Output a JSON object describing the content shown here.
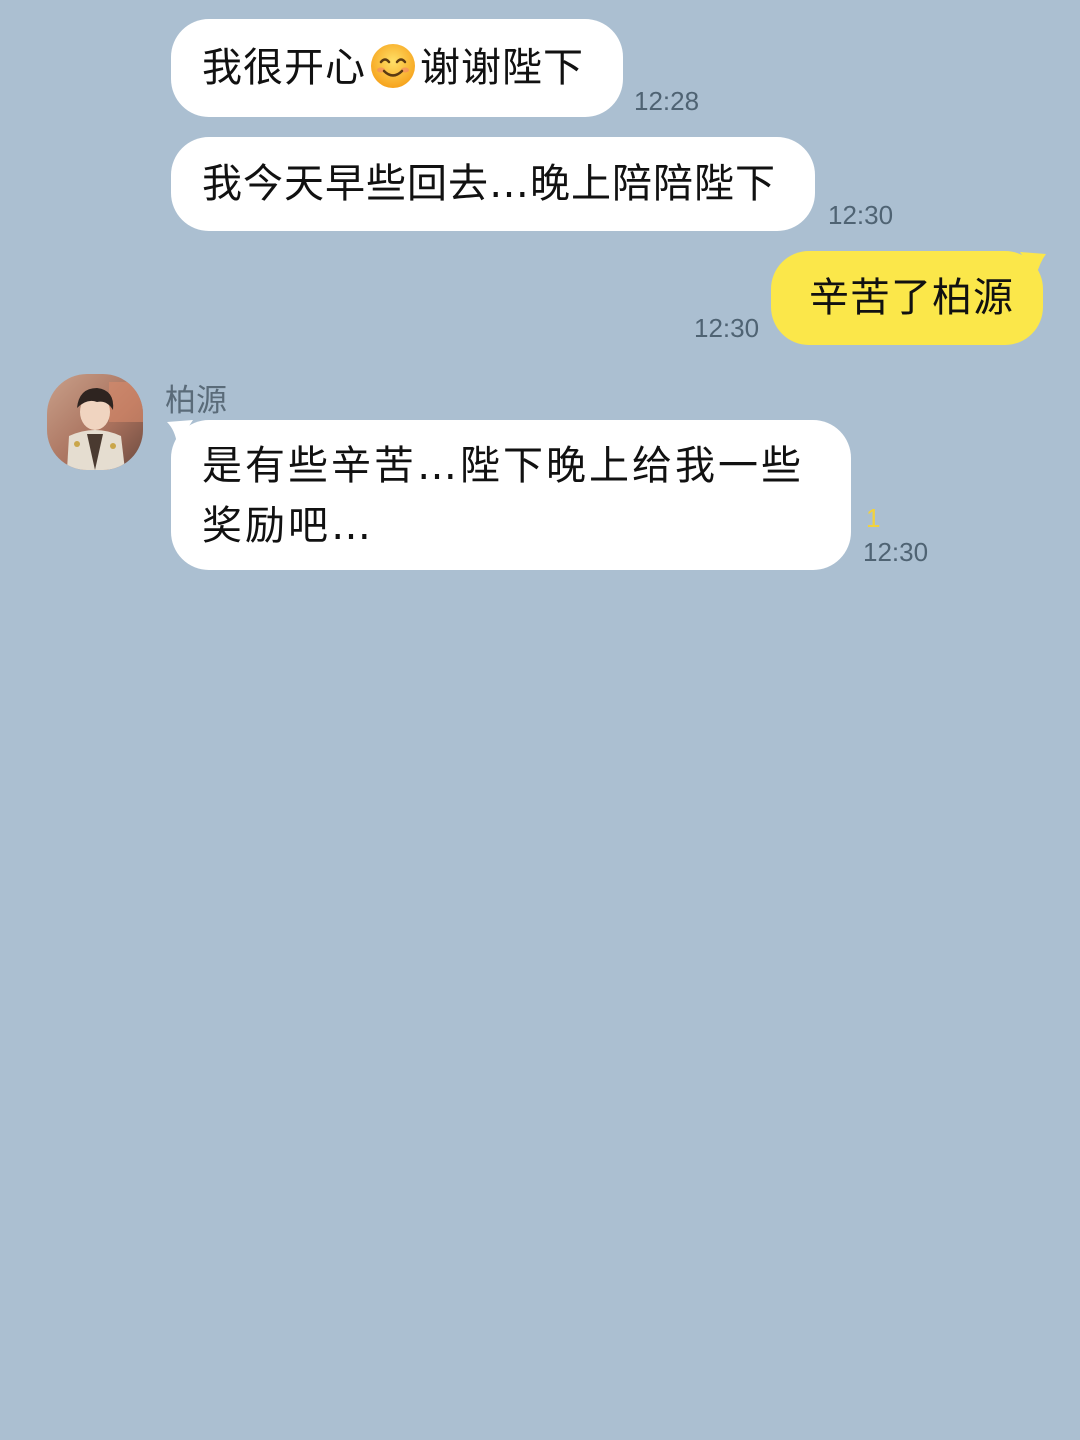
{
  "chat": {
    "messages": [
      {
        "sender": "other",
        "text_before": "我很开心",
        "emoji": "smiling-face-emoji",
        "text_after": "谢谢陛下",
        "time": "12:28"
      },
      {
        "sender": "other",
        "text": "我今天早些回去…晚上陪陪陛下",
        "time": "12:30"
      },
      {
        "sender": "me",
        "text": "辛苦了柏源",
        "time": "12:30"
      },
      {
        "sender": "other",
        "name": "柏源",
        "line1": "是有些辛苦…陛下晚上给我一些",
        "line2": "奖励吧…",
        "unread": "1",
        "time": "12:30"
      }
    ]
  },
  "colors": {
    "background": "#abbfd1",
    "bubble_other": "#ffffff",
    "bubble_mine": "#fbe74a",
    "unread": "#f2d23c"
  }
}
